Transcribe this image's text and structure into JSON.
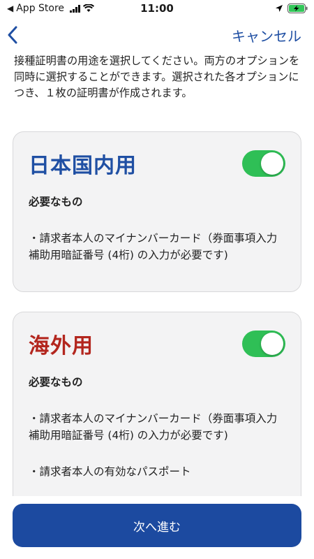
{
  "status_bar": {
    "back_app": "App Store",
    "time": "11:00"
  },
  "nav": {
    "back_icon": "chevron-left-icon",
    "cancel_label": "キャンセル"
  },
  "intro_text": "接種証明書の用途を選択してください。両方のオプションを同時に選択することができます。選択された各オプションにつき、１枚の証明書が作成されます。",
  "options": [
    {
      "title": "日本国内用",
      "title_color": "#1f4fa3",
      "enabled": true,
      "requirements_label": "必要なもの",
      "requirements": [
        "・請求者本人のマイナンバーカード（券面事項入力補助用暗証番号 (4桁) の入力が必要です)"
      ]
    },
    {
      "title": "海外用",
      "title_color": "#b3261e",
      "enabled": true,
      "requirements_label": "必要なもの",
      "requirements": [
        "・請求者本人のマイナンバーカード（券面事項入力補助用暗証番号 (4桁) の入力が必要です)",
        "・請求者本人の有効なパスポート"
      ]
    }
  ],
  "next_button_label": "次へ進む",
  "colors": {
    "accent": "#1f4fa3",
    "button": "#1c4aa0",
    "toggle_on": "#2fbf56",
    "battery": "#32c759"
  }
}
